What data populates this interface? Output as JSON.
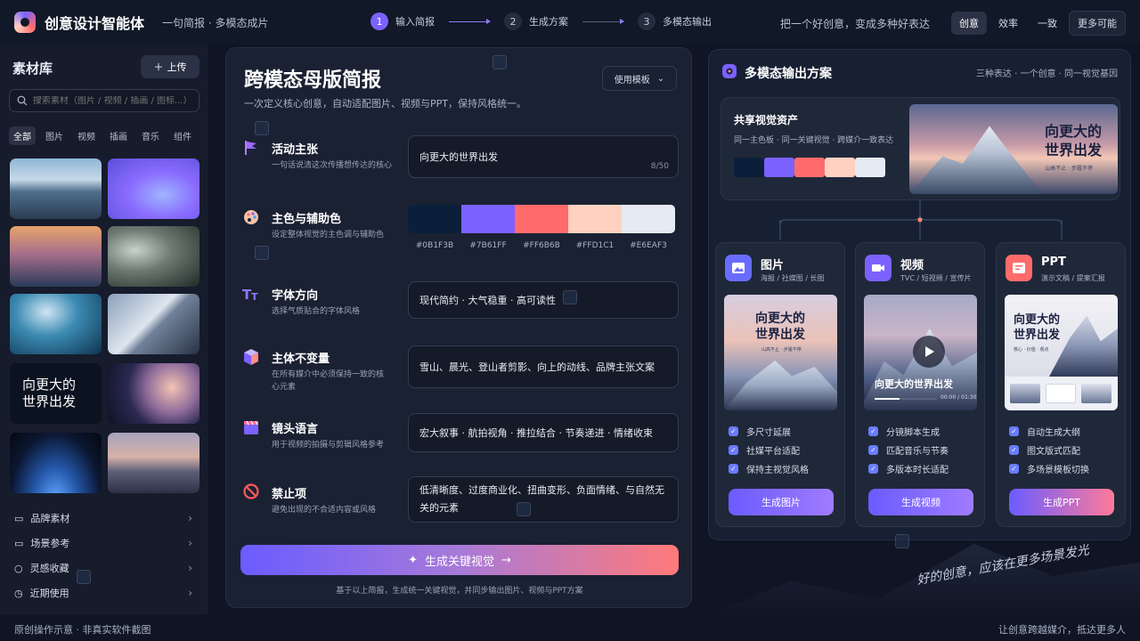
{
  "app": {
    "title": "创意设计智能体",
    "slogan": "一句简报 · 多模态成片"
  },
  "steps": [
    {
      "num": "1",
      "label": "输入简报"
    },
    {
      "num": "2",
      "label": "生成方案"
    },
    {
      "num": "3",
      "label": "多模态输出"
    }
  ],
  "header": {
    "tagline": "把一个好创意，变成多种好表达",
    "modes": [
      "创意",
      "效率",
      "一致"
    ],
    "more": "更多可能"
  },
  "sidebar": {
    "title": "素材库",
    "upload": "上传",
    "search_placeholder": "搜索素材（图片 / 视频 / 插画 / 图标...）",
    "categories": [
      "全部",
      "图片",
      "视频",
      "插画",
      "音乐",
      "组件"
    ],
    "thumb_text": "向更大的\n世界出发",
    "nav": [
      "品牌素材",
      "场景参考",
      "灵感收藏",
      "近期使用"
    ]
  },
  "brief": {
    "title": "跨模态母版简报",
    "subtitle": "一次定义核心创意，自动适配图片、视频与PPT，保持风格统一。",
    "template": "使用模板",
    "rows": [
      {
        "title": "活动主张",
        "desc": "一句话说清这次传播想传达的核心",
        "value": "向更大的世界出发",
        "counter": "8/50"
      },
      {
        "title": "主色与辅助色",
        "desc": "设定整体视觉的主色调与辅助色"
      },
      {
        "title": "字体方向",
        "desc": "选择气质贴合的字体风格",
        "value": "现代简约 · 大气稳重 · 高可读性"
      },
      {
        "title": "主体不变量",
        "desc": "在所有媒介中必须保持一致的核心元素",
        "value": "雪山、晨光、登山者剪影、向上的动线、品牌主张文案"
      },
      {
        "title": "镜头语言",
        "desc": "用于视频的拍摄与剪辑风格参考",
        "value": "宏大叙事 · 航拍视角 · 推拉结合 · 节奏递进 · 情绪收束"
      },
      {
        "title": "禁止项",
        "desc": "避免出现的不合适内容或风格",
        "value": "低清晰度、过度商业化、扭曲变形、负面情绪、与自然无关的元素"
      }
    ],
    "colors": [
      "#0B1F3B",
      "#7B61FF",
      "#FF6B6B",
      "#FFD1C1",
      "#E6EAF3"
    ],
    "color_labels": [
      "#0B1F3B",
      "#7B61FF",
      "#FF6B6B",
      "#FFD1C1",
      "#E6EAF3"
    ],
    "generate": "生成关键视觉",
    "footnote": "基于以上简报，生成统一关键视觉，并同步输出图片、视频与PPT方案"
  },
  "output": {
    "title": "多模态输出方案",
    "note": "三种表达 · 一个创意 · 同一视觉基因",
    "shared_title": "共享视觉资产",
    "shared_sub": "同一主色板 · 同一关键视觉 · 跨媒介一致表达",
    "hero_text": "向更大的\n世界出发",
    "hero_small": "山高不止 · 步履不停",
    "cards": [
      {
        "title": "图片",
        "sub": "海报 / 社媒图 / 长图",
        "checks": [
          "多尺寸延展",
          "社媒平台适配",
          "保持主视觉风格"
        ],
        "button": "生成图片",
        "img_text": "向更大的\n世界出发",
        "img_small": "山高不止 · 步履不停"
      },
      {
        "title": "视频",
        "sub": "TVC / 短视频 / 宣传片",
        "checks": [
          "分镜脚本生成",
          "匹配音乐与节奏",
          "多版本时长适配"
        ],
        "button": "生成视频",
        "img_text": "向更大的世界出发",
        "time": "00:00 / 01:30"
      },
      {
        "title": "PPT",
        "sub": "演示文稿 / 提案汇报",
        "checks": [
          "自动生成大纲",
          "图文版式匹配",
          "多场景模板切换"
        ],
        "button": "生成PPT",
        "img_text": "向更大的\n世界出发",
        "img_small": "核心 · 价值 · 观点"
      }
    ]
  },
  "quote": "好的创意，应该在更多场景发光",
  "footer": {
    "left": "原创操作示意 · 非真实软件截图",
    "right": "让创意跨越媒介，抵达更多人"
  }
}
